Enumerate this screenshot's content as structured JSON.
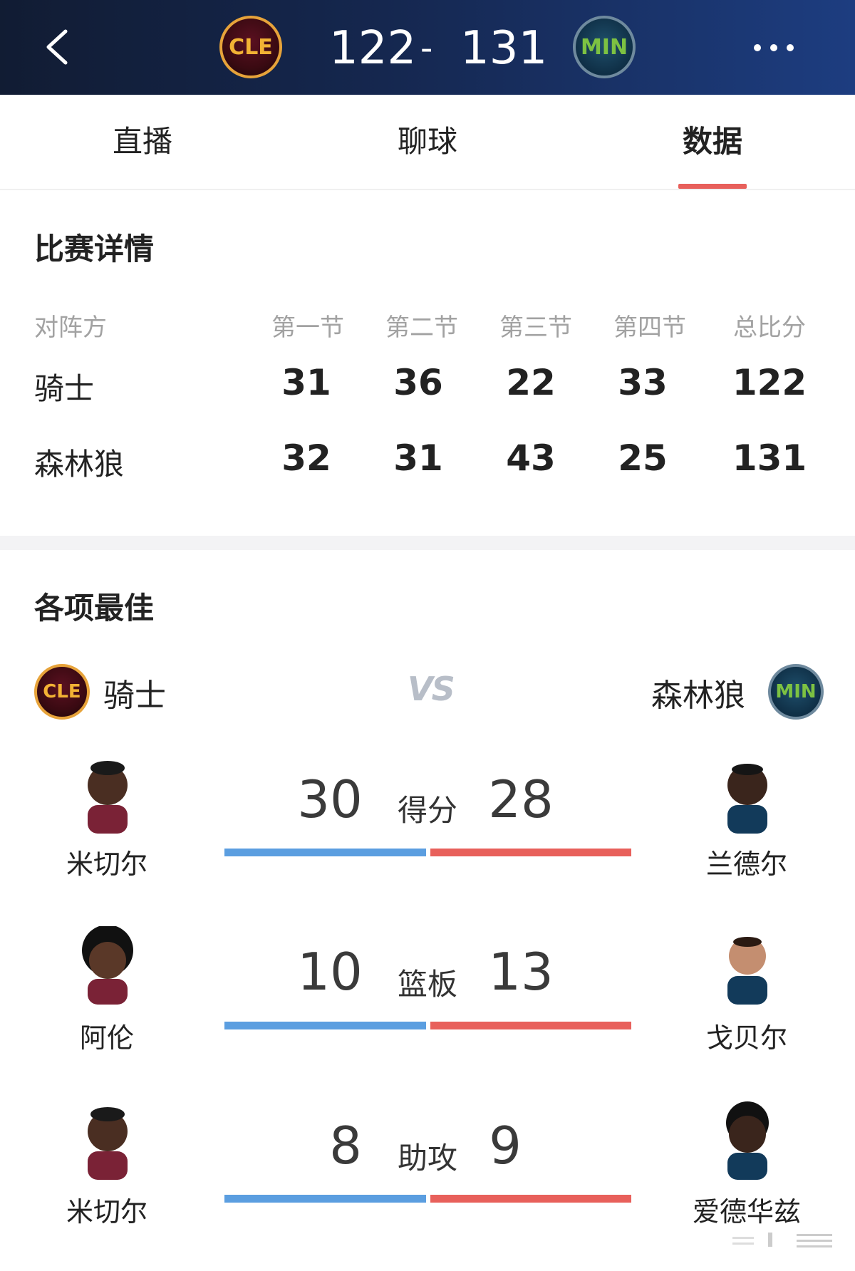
{
  "header": {
    "home_logo": "CLE",
    "away_logo": "MIN",
    "home_score": "122",
    "separator": "-",
    "away_score": "131"
  },
  "tabs": [
    "直播",
    "聊球",
    "数据"
  ],
  "active_tab": "数据",
  "details": {
    "title": "比赛详情",
    "columns": [
      "对阵方",
      "第一节",
      "第二节",
      "第三节",
      "第四节",
      "总比分"
    ],
    "rows": [
      {
        "team": "骑士",
        "scores": [
          "31",
          "36",
          "22",
          "33",
          "122"
        ]
      },
      {
        "team": "森林狼",
        "scores": [
          "32",
          "31",
          "43",
          "25",
          "131"
        ]
      }
    ]
  },
  "leaders": {
    "title": "各项最佳",
    "home_team": "骑士",
    "away_team": "森林狼",
    "vs": "VS",
    "stats": [
      {
        "label": "得分",
        "home_value": "30",
        "away_value": "28",
        "home_player": "米切尔",
        "away_player": "兰德尔"
      },
      {
        "label": "篮板",
        "home_value": "10",
        "away_value": "13",
        "home_player": "阿伦",
        "away_player": "戈贝尔"
      },
      {
        "label": "助攻",
        "home_value": "8",
        "away_value": "9",
        "home_player": "米切尔",
        "away_player": "爱德华兹"
      }
    ]
  },
  "colors": {
    "home_bar": "#5b9ee0",
    "away_bar": "#e8605b",
    "tab_indicator": "#e8605b",
    "header_bg": "#15274f"
  },
  "icons": {
    "back": "chevron-left-icon",
    "more": "more-dots-icon",
    "player": "player-avatar"
  }
}
